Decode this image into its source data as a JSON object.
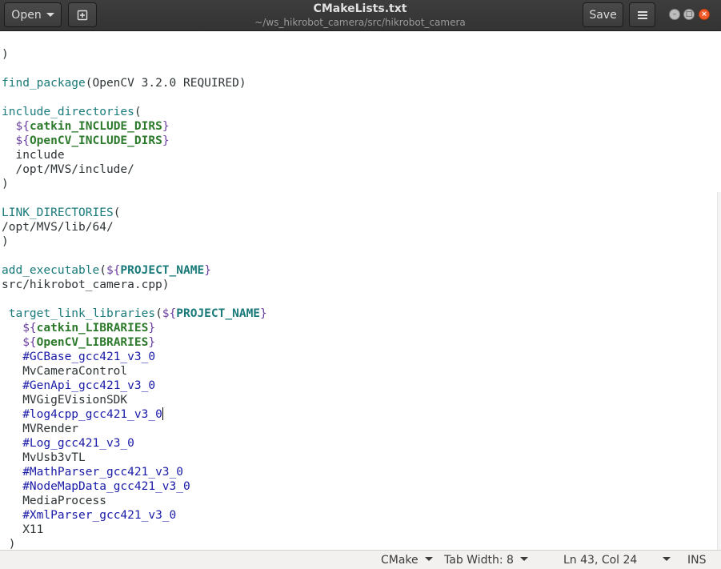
{
  "headerbar": {
    "open_label": "Open",
    "title": "CMakeLists.txt",
    "subtitle": "~/ws_hikrobot_camera/src/hikrobot_camera",
    "save_label": "Save",
    "icons": {
      "new_tab": "new-document-icon",
      "menu": "hamburger-menu-icon",
      "minimize": "minimize-icon",
      "maximize": "maximize-icon",
      "close": "close-icon"
    },
    "colors": {
      "bar": "#333333",
      "close": "#f25b2a"
    }
  },
  "editor": {
    "lines": [
      [
        {
          "t": ")",
          "c": ""
        }
      ],
      [
        {
          "t": "",
          "c": ""
        }
      ],
      [
        {
          "t": "find_package",
          "c": "fn"
        },
        {
          "t": "(OpenCV 3.2.0 REQUIRED)",
          "c": ""
        }
      ],
      [
        {
          "t": "",
          "c": ""
        }
      ],
      [
        {
          "t": "include_directories",
          "c": "fn"
        },
        {
          "t": "(",
          "c": ""
        }
      ],
      [
        {
          "t": "  ",
          "c": ""
        },
        {
          "t": "${",
          "c": "dl"
        },
        {
          "t": "catkin_INCLUDE_DIRS",
          "c": "var"
        },
        {
          "t": "}",
          "c": "dl"
        }
      ],
      [
        {
          "t": "  ",
          "c": ""
        },
        {
          "t": "${",
          "c": "dl"
        },
        {
          "t": "OpenCV_INCLUDE_DIRS",
          "c": "var"
        },
        {
          "t": "}",
          "c": "dl"
        }
      ],
      [
        {
          "t": "  include",
          "c": ""
        }
      ],
      [
        {
          "t": "  /opt/MVS/include/",
          "c": ""
        }
      ],
      [
        {
          "t": ")",
          "c": ""
        }
      ],
      [
        {
          "t": "",
          "c": ""
        }
      ],
      [
        {
          "t": "LINK_DIRECTORIES",
          "c": "fn"
        },
        {
          "t": "(",
          "c": ""
        }
      ],
      [
        {
          "t": "/opt/MVS/lib/64/",
          "c": ""
        }
      ],
      [
        {
          "t": ")",
          "c": ""
        }
      ],
      [
        {
          "t": "",
          "c": ""
        }
      ],
      [
        {
          "t": "add_executable",
          "c": "fn"
        },
        {
          "t": "(",
          "c": ""
        },
        {
          "t": "${",
          "c": "dl"
        },
        {
          "t": "PROJECT_NAME",
          "c": "pn"
        },
        {
          "t": "}",
          "c": "dl"
        }
      ],
      [
        {
          "t": "src/hikrobot_camera.cpp)",
          "c": ""
        }
      ],
      [
        {
          "t": "",
          "c": ""
        }
      ],
      [
        {
          "t": " ",
          "c": ""
        },
        {
          "t": "target_link_libraries",
          "c": "fn"
        },
        {
          "t": "(",
          "c": ""
        },
        {
          "t": "${",
          "c": "dl"
        },
        {
          "t": "PROJECT_NAME",
          "c": "pn"
        },
        {
          "t": "}",
          "c": "dl"
        }
      ],
      [
        {
          "t": "   ",
          "c": ""
        },
        {
          "t": "${",
          "c": "dl"
        },
        {
          "t": "catkin_LIBRARIES",
          "c": "var"
        },
        {
          "t": "}",
          "c": "dl"
        }
      ],
      [
        {
          "t": "   ",
          "c": ""
        },
        {
          "t": "${",
          "c": "dl"
        },
        {
          "t": "OpenCV_LIBRARIES",
          "c": "var"
        },
        {
          "t": "}",
          "c": "dl"
        }
      ],
      [
        {
          "t": "   ",
          "c": ""
        },
        {
          "t": "#GCBase_gcc421_v3_0",
          "c": "cm"
        }
      ],
      [
        {
          "t": "   MvCameraControl",
          "c": ""
        }
      ],
      [
        {
          "t": "   ",
          "c": ""
        },
        {
          "t": "#GenApi_gcc421_v3_0",
          "c": "cm"
        }
      ],
      [
        {
          "t": "   MVGigEVisionSDK",
          "c": ""
        }
      ],
      [
        {
          "t": "   ",
          "c": ""
        },
        {
          "t": "#log4cpp_gcc421_v3_0",
          "c": "cm"
        },
        {
          "t": "",
          "c": "cursor"
        }
      ],
      [
        {
          "t": "   MVRender",
          "c": ""
        }
      ],
      [
        {
          "t": "   ",
          "c": ""
        },
        {
          "t": "#Log_gcc421_v3_0",
          "c": "cm"
        }
      ],
      [
        {
          "t": "   MvUsb3vTL",
          "c": ""
        }
      ],
      [
        {
          "t": "   ",
          "c": ""
        },
        {
          "t": "#MathParser_gcc421_v3_0",
          "c": "cm"
        }
      ],
      [
        {
          "t": "   ",
          "c": ""
        },
        {
          "t": "#NodeMapData_gcc421_v3_0",
          "c": "cm"
        }
      ],
      [
        {
          "t": "   MediaProcess",
          "c": ""
        }
      ],
      [
        {
          "t": "   ",
          "c": ""
        },
        {
          "t": "#XmlParser_gcc421_v3_0",
          "c": "cm"
        }
      ],
      [
        {
          "t": "   X11",
          "c": ""
        }
      ],
      [
        {
          "t": " )",
          "c": ""
        }
      ]
    ],
    "colors": {
      "function": "#1a7a7a",
      "delimiter": "#6a3fa0",
      "variable": "#2d7a2d",
      "comment": "#1a1aa8"
    }
  },
  "statusbar": {
    "language": "CMake",
    "tab_width": "Tab Width: 8",
    "position": "Ln 43, Col 24",
    "insert_mode": "INS"
  }
}
